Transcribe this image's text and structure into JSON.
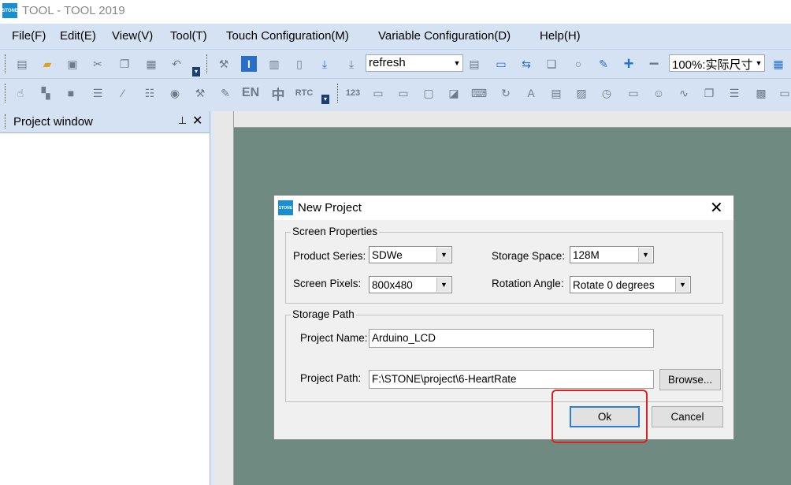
{
  "app": {
    "icon_text": "STONE",
    "title": "TOOL - TOOL 2019"
  },
  "menu": [
    "File(F)",
    "Edit(E)",
    "View(V)",
    "Tool(T)",
    "Touch Configuration(M)",
    "Variable Configuration(D)",
    "Help(H)"
  ],
  "toolbar1": {
    "refresh_value": "refresh",
    "zoom_value": "100%:实际尺寸"
  },
  "toolbar2": {
    "en_label": "EN",
    "zh_label": "中",
    "rtc_label": "RTC",
    "num_label": "123"
  },
  "project_window": {
    "title": "Project window",
    "pin_icon": "pin-icon",
    "close_icon": "close-icon"
  },
  "dialog": {
    "icon_text": "STONE",
    "title": "New Project",
    "screen_properties": {
      "label": "Screen Properties",
      "product_series_label": "Product Series:",
      "product_series_value": "SDWe",
      "storage_space_label": "Storage Space:",
      "storage_space_value": "128M",
      "screen_pixels_label": "Screen Pixels:",
      "screen_pixels_value": "800x480",
      "rotation_angle_label": "Rotation Angle:",
      "rotation_angle_value": "Rotate 0 degrees"
    },
    "storage_path": {
      "label": "Storage Path",
      "project_name_label": "Project Name:",
      "project_name_value": "Arduino_LCD",
      "project_path_label": "Project Path:",
      "project_path_value": "F:\\STONE\\project\\6-HeartRate",
      "browse_label": "Browse..."
    },
    "ok_label": "Ok",
    "cancel_label": "Cancel"
  },
  "colors": {
    "accent": "#1a8fd0",
    "highlight": "#e02020",
    "canvas": "#6f8a80"
  }
}
